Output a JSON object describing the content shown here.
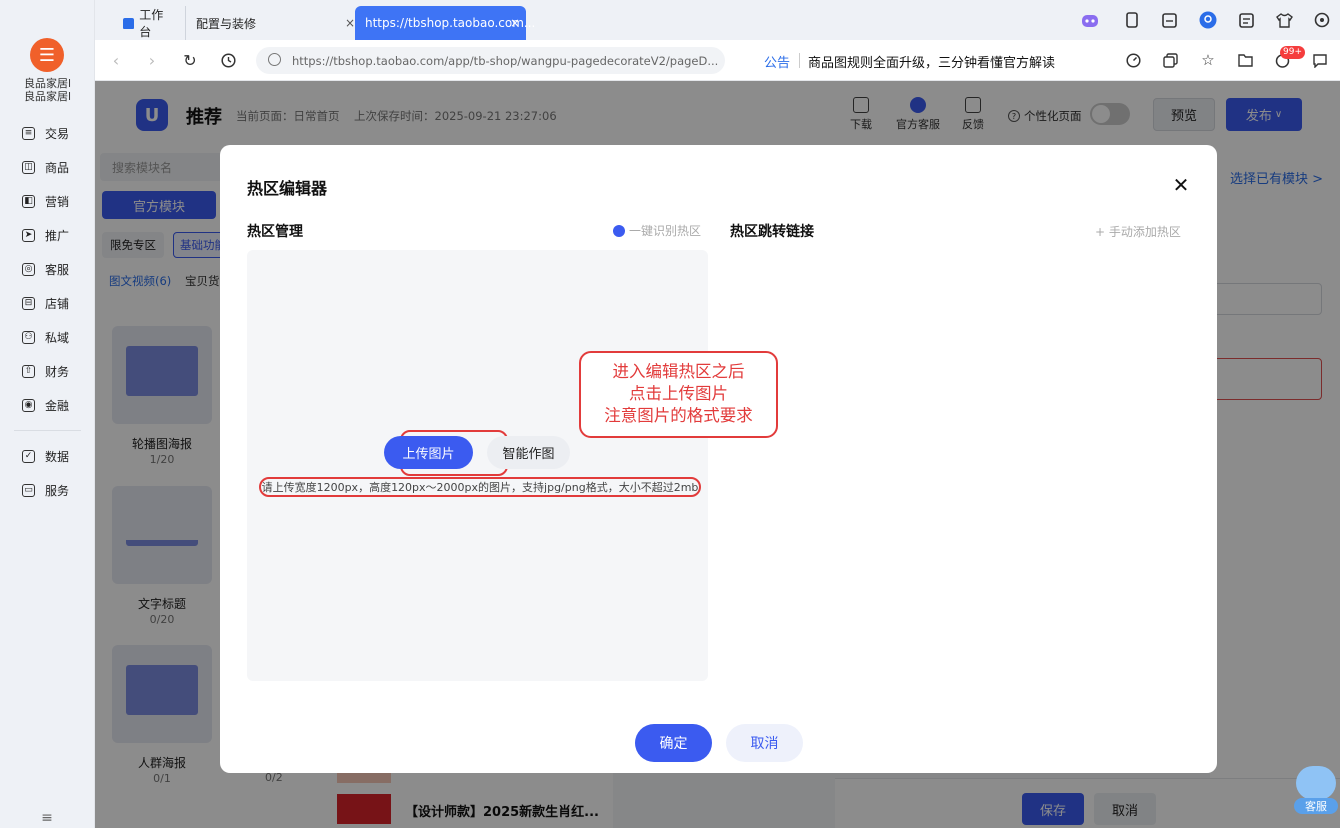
{
  "sidebar": {
    "logo": "☰",
    "shop_name_1": "良品家居l",
    "shop_name_2": "良品家居l",
    "items": [
      {
        "label": "交易",
        "icon": "≡"
      },
      {
        "label": "商品",
        "icon": "◫"
      },
      {
        "label": "营销",
        "icon": "◧"
      },
      {
        "label": "推广",
        "icon": "➤"
      },
      {
        "label": "客服",
        "icon": "◎"
      },
      {
        "label": "店铺",
        "icon": "⊟"
      },
      {
        "label": "私域",
        "icon": "⚇"
      },
      {
        "label": "财务",
        "icon": "⇧"
      },
      {
        "label": "金融",
        "icon": "◉"
      }
    ],
    "items2": [
      {
        "label": "数据",
        "icon": "✓"
      },
      {
        "label": "服务",
        "icon": "▭"
      }
    ],
    "menu_icon": "≡"
  },
  "tabs": {
    "workbench": "工作台",
    "config": "配置与装修",
    "active": "https://tbshop.taobao.com...",
    "close": "×"
  },
  "address": {
    "url": "https://tbshop.taobao.com/app/tb-shop/wangpu-pagedecorateV2/pageD...",
    "notice_label": "公告",
    "notice_text": "商品图规则全面升级，三分钟看懂官方解读",
    "badge": "99+"
  },
  "header": {
    "title": "推荐",
    "current_page": "当前页面：日常首页",
    "last_saved": "上次保存时间：2025-09-21 23:27:06",
    "download": "下载",
    "service": "官方客服",
    "feedback": "反馈",
    "personalize": "个性化页面",
    "preview": "预览",
    "publish": "发布"
  },
  "module_panel": {
    "search_placeholder": "搜索模块名",
    "official_tab": "官方模块",
    "chip_free": "限免专区",
    "chip_basic": "基础功能",
    "subtab_video": "图文视频(6)",
    "subtab_goods": "宝贝货",
    "modules": [
      {
        "name": "轮播图海报",
        "count": "1/20"
      },
      {
        "name": "文字标题",
        "count": "0/20"
      },
      {
        "name": "人群海报",
        "count": "0/1"
      }
    ],
    "extra_count": "0/2"
  },
  "item_list": {
    "title": "【设计师款】2025新款生肖红..."
  },
  "prop_panel": {
    "choose_module": "选择已有模块 >"
  },
  "bottom": {
    "save": "保存",
    "cancel": "取消"
  },
  "modal": {
    "title": "热区编辑器",
    "close": "✕",
    "mgmt_title": "热区管理",
    "auto_detect": "一键识别热区",
    "link_title": "热区跳转链接",
    "manual_add": "+ 手动添加热区",
    "upload": "上传图片",
    "smart": "智能作图",
    "format_note": "请上传宽度1200px，高度120px～2000px的图片，支持jpg/png格式，大小不超过2mb",
    "callout_1": "进入编辑热区之后",
    "callout_2": "点击上传图片",
    "callout_3": "注意图片的格式要求",
    "confirm": "确定",
    "cancel": "取消"
  },
  "service_bot": {
    "label": "客服"
  }
}
